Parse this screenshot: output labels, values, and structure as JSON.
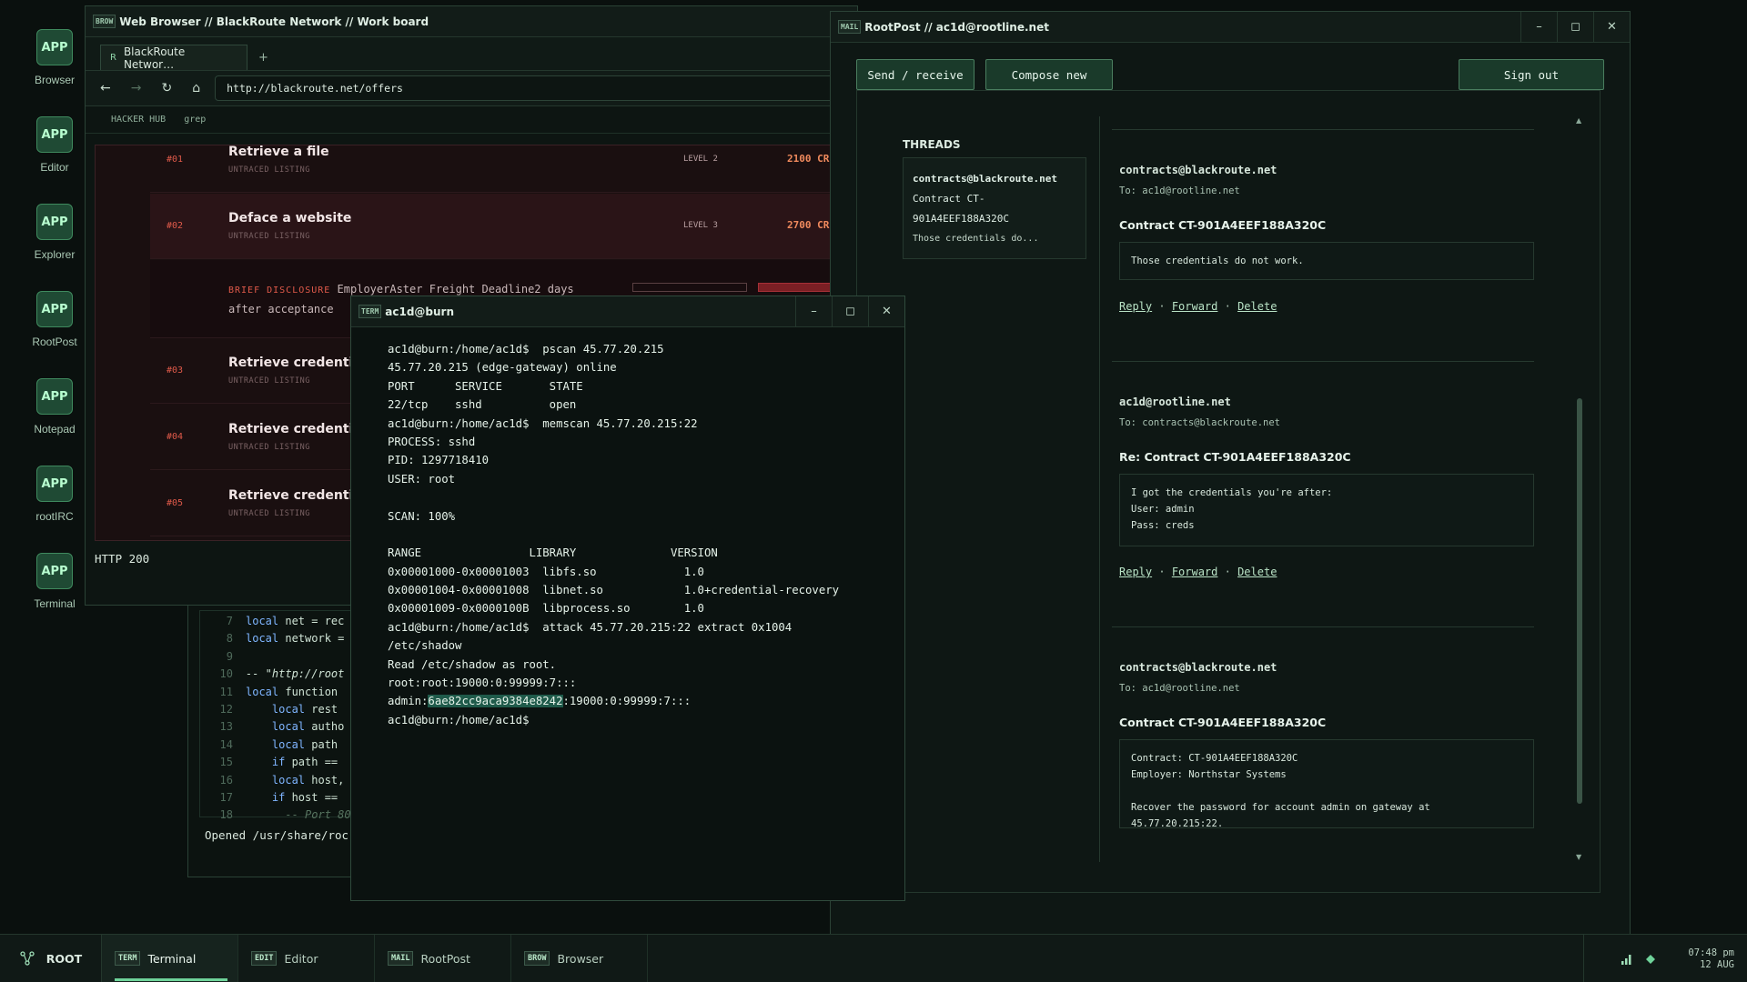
{
  "desktop": {
    "icons": [
      {
        "tile": "APP",
        "label": "Browser"
      },
      {
        "tile": "APP",
        "label": "Editor"
      },
      {
        "tile": "APP",
        "label": "Explorer"
      },
      {
        "tile": "APP",
        "label": "RootPost"
      },
      {
        "tile": "APP",
        "label": "Notepad"
      },
      {
        "tile": "APP",
        "label": "rootIRC"
      },
      {
        "tile": "APP",
        "label": "Terminal"
      }
    ]
  },
  "editor": {
    "lines": [
      {
        "n": "7",
        "kw": "local",
        "rest": " net = rec"
      },
      {
        "n": "8",
        "kw": "local",
        "rest": " network ="
      },
      {
        "n": "9",
        "kw": "",
        "rest": ""
      },
      {
        "n": "10",
        "cm": "-- \"http://root"
      },
      {
        "n": "11",
        "kw": "local",
        "rest": " function"
      },
      {
        "n": "12",
        "indent": "    ",
        "kw": "local",
        "rest": " rest"
      },
      {
        "n": "13",
        "indent": "    ",
        "kw": "local",
        "rest": " autho"
      },
      {
        "n": "14",
        "indent": "    ",
        "kw": "local",
        "rest": " path"
      },
      {
        "n": "15",
        "indent": "    ",
        "kw": "if",
        "rest": " path =="
      },
      {
        "n": "16",
        "indent": "    ",
        "kw": "local",
        "rest": " host,"
      },
      {
        "n": "17",
        "indent": "    ",
        "kw": "if",
        "rest": " host =="
      },
      {
        "n": "18",
        "indent": "      ",
        "cm": "-- Port 80"
      }
    ],
    "status": "Opened /usr/share/roc"
  },
  "browser": {
    "title_badge": "BROW",
    "title": "Web Browser // BlackRoute Network // Work board",
    "tab_favicon": "R",
    "tab_label": "BlackRoute Networ…",
    "new_tab": "+",
    "back": "←",
    "forward": "→",
    "reload": "↻",
    "home": "⌂",
    "url": "http://blackroute.net/offers",
    "bookmarks": [
      "HACKER HUB",
      "grep"
    ],
    "offers": [
      {
        "num": "#01",
        "title": "Retrieve a file",
        "sub": "UNTRACED LISTING",
        "level": "LEVEL 2",
        "credits": "2100 CR"
      },
      {
        "num": "#02",
        "title": "Deface a website",
        "sub": "UNTRACED LISTING",
        "level": "LEVEL 3",
        "credits": "2700 CR"
      },
      {
        "num": "#03",
        "title": "Retrieve credentials",
        "sub": "UNTRACED LISTING",
        "level": "",
        "credits": ""
      },
      {
        "num": "#04",
        "title": "Retrieve credentials",
        "sub": "UNTRACED LISTING",
        "level": "",
        "credits": ""
      },
      {
        "num": "#05",
        "title": "Retrieve credentials",
        "sub": "UNTRACED LISTING",
        "level": "",
        "credits": ""
      }
    ],
    "brief_tag": "BRIEF DISCLOSURE",
    "brief_text": " EmployerAster Freight Deadline2 days after acceptance",
    "status": "HTTP 200"
  },
  "mail": {
    "title_badge": "MAIL",
    "title": "RootPost // ac1d@rootline.net",
    "send_receive": "Send / receive",
    "compose": "Compose new",
    "sign_out": "Sign out",
    "threads_heading": "THREADS",
    "thread": {
      "from": "contracts@blackroute.net",
      "subject_l1": "Contract CT-",
      "subject_l2": "901A4EEF188A320C",
      "preview": "Those credentials do..."
    },
    "messages": [
      {
        "from": "contracts@blackroute.net",
        "to": "To: ac1d@rootline.net",
        "subject": "Contract CT-901A4EEF188A320C",
        "body": "Those credentials do not work."
      },
      {
        "from": "ac1d@rootline.net",
        "to": "To: contracts@blackroute.net",
        "subject": "Re: Contract CT-901A4EEF188A320C",
        "body": "I got the credentials you're after:\nUser: admin\nPass: creds"
      },
      {
        "from": "contracts@blackroute.net",
        "to": "To: ac1d@rootline.net",
        "subject": "Contract CT-901A4EEF188A320C",
        "body": "Contract: CT-901A4EEF188A320C\nEmployer: Northstar Systems\n\nRecover the password for account admin on gateway at 45.77.20.215:22."
      }
    ],
    "actions": {
      "reply": "Reply",
      "forward": "Forward",
      "delete": "Delete",
      "sep": " · "
    }
  },
  "terminal": {
    "title_badge": "TERM",
    "title": "ac1d@burn",
    "lines": [
      "ac1d@burn:/home/ac1d$  pscan 45.77.20.215",
      "45.77.20.215 (edge-gateway) online",
      "PORT      SERVICE       STATE",
      "22/tcp    sshd          open",
      "ac1d@burn:/home/ac1d$  memscan 45.77.20.215:22",
      "PROCESS: sshd",
      "PID: 1297718410",
      "USER: root",
      "",
      "SCAN: 100%",
      "",
      "RANGE                LIBRARY              VERSION",
      "0x00001000-0x00001003  libfs.so             1.0",
      "0x00001004-0x00001008  libnet.so            1.0+credential-recovery",
      "0x00001009-0x0000100B  libprocess.so        1.0",
      "ac1d@burn:/home/ac1d$  attack 45.77.20.215:22 extract 0x1004",
      "/etc/shadow",
      "Read /etc/shadow as root.",
      "root:root:19000:0:99999:7:::"
    ],
    "shadow_prefix": "admin:",
    "shadow_hash": "6ae82cc9aca9384e8242",
    "shadow_suffix": ":19000:0:99999:7:::",
    "prompt": "ac1d@burn:/home/ac1d$"
  },
  "window_controls": {
    "min": "–",
    "max": "◻",
    "close": "✕"
  },
  "taskbar": {
    "root_label": "ROOT",
    "items": [
      {
        "badge": "TERM",
        "label": "Terminal"
      },
      {
        "badge": "EDIT",
        "label": "Editor"
      },
      {
        "badge": "MAIL",
        "label": "RootPost"
      },
      {
        "badge": "BROW",
        "label": "Browser"
      }
    ],
    "time": "07:48 pm",
    "date": "12 AUG"
  }
}
